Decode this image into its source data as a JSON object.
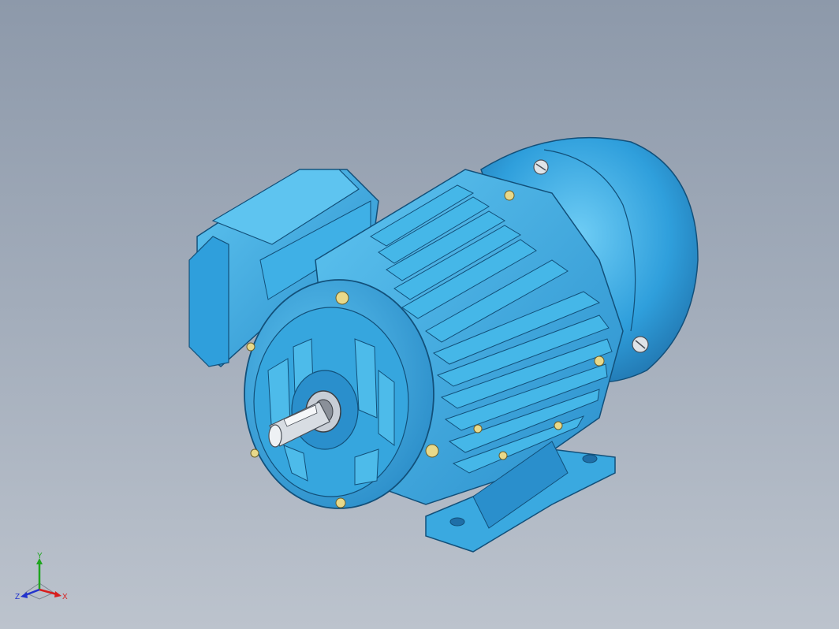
{
  "viewport": {
    "background_top": "#8d99aa",
    "background_bottom": "#bcc3cd"
  },
  "model": {
    "body_color": "#2f9fdc",
    "body_highlight": "#5fc6f2",
    "body_dark": "#1f6fa8",
    "fin_color": "#45b7e8",
    "bolt_color": "#e8d98a",
    "shaft_color": "#d8dde3"
  },
  "triad": {
    "x_label": "X",
    "y_label": "Y",
    "z_label": "Z",
    "x_color": "#d81e1e",
    "y_color": "#1fa51f",
    "z_color": "#2233cc"
  }
}
